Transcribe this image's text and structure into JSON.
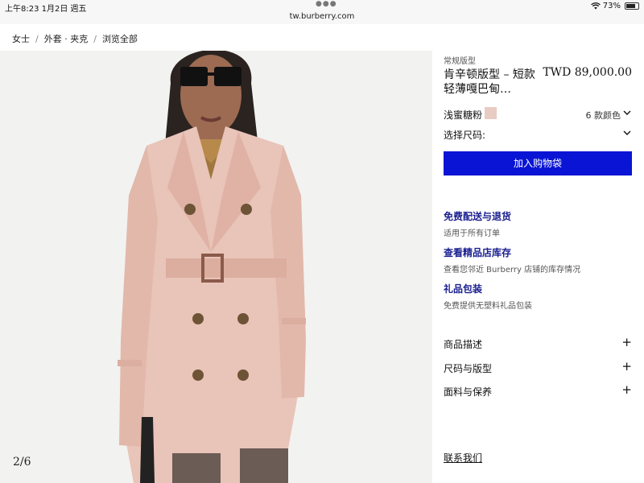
{
  "status_bar": {
    "time_date": "上午8:23   1月2日 週五",
    "url": "tw.burberry.com",
    "battery": "73%"
  },
  "breadcrumb": [
    "女士",
    "外套 · 夹克",
    "浏览全部"
  ],
  "gallery": {
    "counter": "2/6"
  },
  "product": {
    "fit": "常规版型",
    "title_line1": "肯辛顿版型 – 短款",
    "title_line2": "轻薄嘎巴甸…",
    "price": "TWD 89,000.00",
    "color_name": "浅蜜糖粉",
    "swatch_color": "#e8cbc2",
    "color_count": "6 款颜色",
    "size_label": "选择尺码:",
    "add_to_bag": "加入购物袋"
  },
  "services": [
    {
      "title": "免费配送与退货",
      "subtitle": "适用于所有订单"
    },
    {
      "title": "查看精品店库存",
      "subtitle": "查看您邻近 Burberry 店铺的库存情况"
    },
    {
      "title": "礼品包装",
      "subtitle": "免费提供无塑料礼品包装"
    }
  ],
  "accordions": [
    "商品描述",
    "尺码与版型",
    "面料与保养"
  ],
  "contact": "联系我们",
  "colors": {
    "accent": "#0a14d4",
    "link": "#1a1f8f"
  }
}
